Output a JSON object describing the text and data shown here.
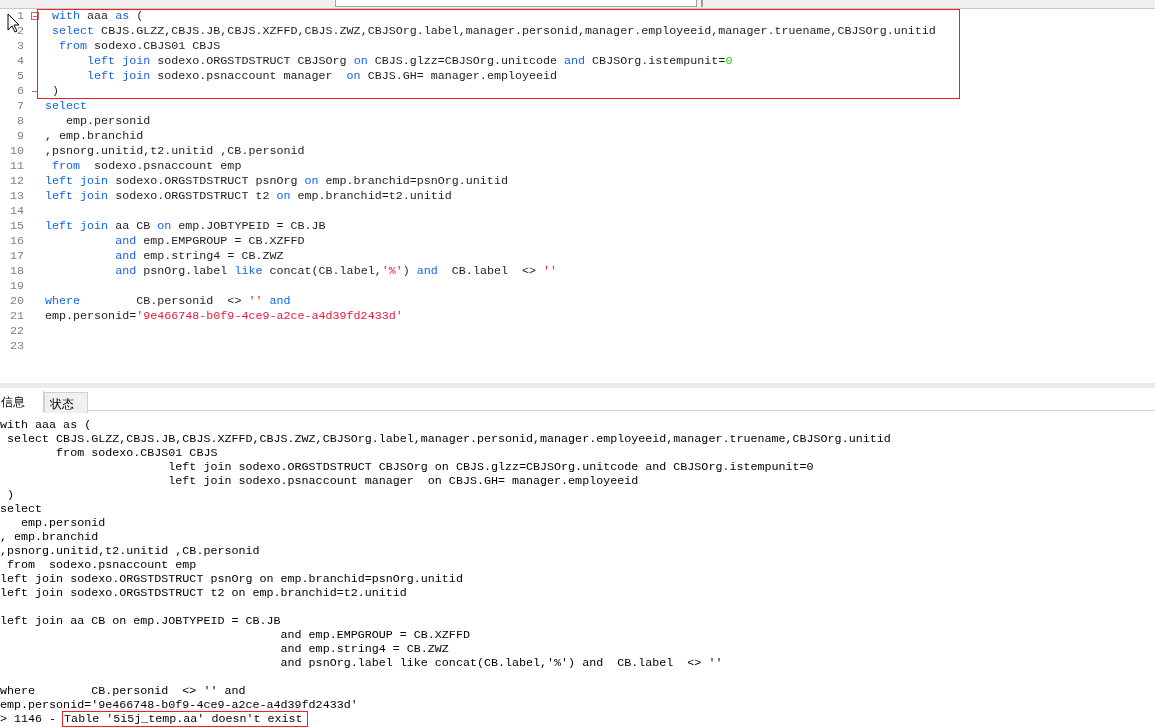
{
  "toolbar": {
    "fields": [
      {
        "kind": "field"
      },
      {
        "kind": "field"
      }
    ]
  },
  "editor": {
    "blocks": [
      {
        "highlighted": true,
        "lines": [
          {
            "number": "1",
            "fold_start": true,
            "fold_end": false,
            "tokens": [
              {
                "text": " with",
                "kind": "kw"
              },
              {
                "text": " aaa ",
                "kind": "plain"
              },
              {
                "text": "as",
                "kind": "kw"
              },
              {
                "text": " (",
                "kind": "plain"
              }
            ]
          },
          {
            "number": "2",
            "fold_start": false,
            "fold_end": false,
            "tokens": [
              {
                "text": " select",
                "kind": "kw"
              },
              {
                "text": " CBJS.GLZZ,CBJS.JB,CBJS.XZFFD,CBJS.ZWZ,CBJSOrg.label,manager.personid,manager.employeeid,manager.truename,CBJSOrg.unitid",
                "kind": "plain"
              }
            ]
          },
          {
            "number": "3",
            "fold_start": false,
            "fold_end": false,
            "tokens": [
              {
                "text": "  from",
                "kind": "kw"
              },
              {
                "text": " sodexo.CBJS01 CBJS",
                "kind": "plain"
              }
            ]
          },
          {
            "number": "4",
            "fold_start": false,
            "fold_end": false,
            "tokens": [
              {
                "text": "      left join",
                "kind": "kw"
              },
              {
                "text": " sodexo.ORGSTDSTRUCT CBJSOrg ",
                "kind": "plain"
              },
              {
                "text": "on",
                "kind": "kw"
              },
              {
                "text": " CBJS.glzz=CBJSOrg.unitcode ",
                "kind": "plain"
              },
              {
                "text": "and",
                "kind": "kw"
              },
              {
                "text": " CBJSOrg.istempunit=",
                "kind": "plain"
              },
              {
                "text": "0",
                "kind": "num"
              }
            ]
          },
          {
            "number": "5",
            "fold_start": false,
            "fold_end": false,
            "tokens": [
              {
                "text": "      left join",
                "kind": "kw"
              },
              {
                "text": " sodexo.psnaccount manager  ",
                "kind": "plain"
              },
              {
                "text": "on",
                "kind": "kw"
              },
              {
                "text": " CBJS.GH= manager.employeeid",
                "kind": "plain"
              }
            ]
          },
          {
            "number": "6",
            "fold_start": false,
            "fold_end": true,
            "tokens": [
              {
                "text": " )",
                "kind": "plain"
              }
            ]
          }
        ]
      },
      {
        "highlighted": false,
        "lines": [
          {
            "number": "7",
            "fold_start": false,
            "fold_end": false,
            "tokens": [
              {
                "text": "select",
                "kind": "kw"
              }
            ]
          },
          {
            "number": "8",
            "fold_start": false,
            "fold_end": false,
            "tokens": [
              {
                "text": "   emp.personid",
                "kind": "plain"
              }
            ]
          },
          {
            "number": "9",
            "fold_start": false,
            "fold_end": false,
            "tokens": [
              {
                "text": ", emp.branchid",
                "kind": "plain"
              }
            ]
          },
          {
            "number": "10",
            "fold_start": false,
            "fold_end": false,
            "tokens": [
              {
                "text": ",psnorg.unitid,t2.unitid ,CB.personid",
                "kind": "plain"
              }
            ]
          },
          {
            "number": "11",
            "fold_start": false,
            "fold_end": false,
            "tokens": [
              {
                "text": " from",
                "kind": "kw"
              },
              {
                "text": "  sodexo.psnaccount emp",
                "kind": "plain"
              }
            ]
          },
          {
            "number": "12",
            "fold_start": false,
            "fold_end": false,
            "tokens": [
              {
                "text": "left join",
                "kind": "kw"
              },
              {
                "text": " sodexo.ORGSTDSTRUCT psnOrg ",
                "kind": "plain"
              },
              {
                "text": "on",
                "kind": "kw"
              },
              {
                "text": " emp.branchid=psnOrg.unitid",
                "kind": "plain"
              }
            ]
          },
          {
            "number": "13",
            "fold_start": false,
            "fold_end": false,
            "tokens": [
              {
                "text": "left join",
                "kind": "kw"
              },
              {
                "text": " sodexo.ORGSTDSTRUCT t2 ",
                "kind": "plain"
              },
              {
                "text": "on",
                "kind": "kw"
              },
              {
                "text": " emp.branchid=t2.unitid",
                "kind": "plain"
              }
            ]
          },
          {
            "number": "14",
            "fold_start": false,
            "fold_end": false
          },
          {
            "number": "15",
            "fold_start": false,
            "fold_end": false,
            "tokens": [
              {
                "text": "left join",
                "kind": "kw"
              },
              {
                "text": " aa CB ",
                "kind": "plain"
              },
              {
                "text": "on",
                "kind": "kw"
              },
              {
                "text": " emp.JOBTYPEID = CB.JB",
                "kind": "plain"
              }
            ]
          },
          {
            "number": "16",
            "fold_start": false,
            "fold_end": false,
            "tokens": [
              {
                "text": "          and",
                "kind": "kw"
              },
              {
                "text": " emp.EMPGROUP = CB.XZFFD",
                "kind": "plain"
              }
            ]
          },
          {
            "number": "17",
            "fold_start": false,
            "fold_end": false,
            "tokens": [
              {
                "text": "          and",
                "kind": "kw"
              },
              {
                "text": " emp.string4 = CB.ZWZ",
                "kind": "plain"
              }
            ]
          },
          {
            "number": "18",
            "fold_start": false,
            "fold_end": false,
            "tokens": [
              {
                "text": "          and",
                "kind": "kw"
              },
              {
                "text": " psnOrg.label ",
                "kind": "plain"
              },
              {
                "text": "like",
                "kind": "kw"
              },
              {
                "text": " concat(CB.label,",
                "kind": "plain"
              },
              {
                "text": "'%'",
                "kind": "str"
              },
              {
                "text": ") ",
                "kind": "plain"
              },
              {
                "text": "and",
                "kind": "kw"
              },
              {
                "text": "  CB.label  <> ",
                "kind": "plain"
              },
              {
                "text": "''",
                "kind": "str"
              }
            ]
          },
          {
            "number": "19",
            "fold_start": false,
            "fold_end": false
          },
          {
            "number": "20",
            "fold_start": false,
            "fold_end": false,
            "tokens": [
              {
                "text": "where",
                "kind": "kw"
              },
              {
                "text": "        CB.personid  <> ",
                "kind": "plain"
              },
              {
                "text": "''",
                "kind": "str"
              },
              {
                "text": " and",
                "kind": "kw"
              }
            ]
          },
          {
            "number": "21",
            "fold_start": false,
            "fold_end": false,
            "tokens": [
              {
                "text": "emp.personid=",
                "kind": "plain"
              },
              {
                "text": "'9e466748-b0f9-4ce9-a2ce-a4d39fd2433d'",
                "kind": "str"
              }
            ]
          },
          {
            "number": "22",
            "fold_start": false,
            "fold_end": false
          },
          {
            "number": "23",
            "fold_start": false,
            "fold_end": false
          }
        ]
      }
    ]
  },
  "tabs": [
    {
      "label": "信息",
      "selected": true
    },
    {
      "label": "状态",
      "selected": false
    }
  ],
  "output": {
    "lines": [
      {
        "kind": "text",
        "text": "with aaa as ("
      },
      {
        "kind": "text",
        "text": " select CBJS.GLZZ,CBJS.JB,CBJS.XZFFD,CBJS.ZWZ,CBJSOrg.label,manager.personid,manager.employeeid,manager.truename,CBJSOrg.unitid"
      },
      {
        "kind": "text",
        "text": "        from sodexo.CBJS01 CBJS"
      },
      {
        "kind": "text",
        "text": "                        left join sodexo.ORGSTDSTRUCT CBJSOrg on CBJS.glzz=CBJSOrg.unitcode and CBJSOrg.istempunit=0"
      },
      {
        "kind": "text",
        "text": "                        left join sodexo.psnaccount manager  on CBJS.GH= manager.employeeid"
      },
      {
        "kind": "text",
        "text": " )"
      },
      {
        "kind": "text",
        "text": "select"
      },
      {
        "kind": "text",
        "text": "   emp.personid"
      },
      {
        "kind": "text",
        "text": ", emp.branchid"
      },
      {
        "kind": "text",
        "text": ",psnorg.unitid,t2.unitid ,CB.personid"
      },
      {
        "kind": "text",
        "text": " from  sodexo.psnaccount emp"
      },
      {
        "kind": "text",
        "text": "left join sodexo.ORGSTDSTRUCT psnOrg on emp.branchid=psnOrg.unitid"
      },
      {
        "kind": "text",
        "text": "left join sodexo.ORGSTDSTRUCT t2 on emp.branchid=t2.unitid"
      },
      {
        "kind": "blank"
      },
      {
        "kind": "text",
        "text": "left join aa CB on emp.JOBTYPEID = CB.JB"
      },
      {
        "kind": "text",
        "text": "                                        and emp.EMPGROUP = CB.XZFFD"
      },
      {
        "kind": "text",
        "text": "                                        and emp.string4 = CB.ZWZ"
      },
      {
        "kind": "text",
        "text": "                                        and psnOrg.label like concat(CB.label,'%') and  CB.label  <> ''"
      },
      {
        "kind": "blank"
      },
      {
        "kind": "text",
        "text": "where        CB.personid  <> '' and"
      },
      {
        "kind": "text",
        "text": "emp.personid='9e466748-b0f9-4ce9-a2ce-a4d39fd2433d'"
      }
    ],
    "error": {
      "prefix": "> 1146 -",
      "message": "Table '5i5j_temp.aa' doesn't exist",
      "highlighted": true
    }
  }
}
